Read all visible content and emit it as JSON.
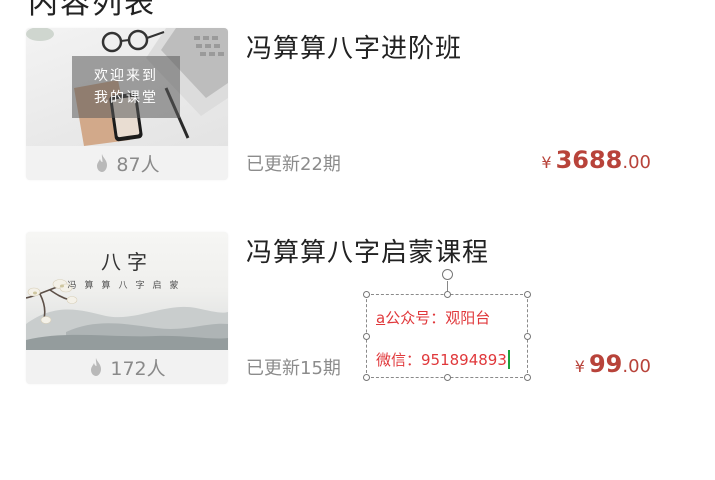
{
  "header": {
    "cut_text": "内容列表"
  },
  "courses": [
    {
      "title": "冯算算八字进阶班",
      "updated": "已更新22期",
      "students": "87人",
      "price_symbol": "¥",
      "price_int": "3688",
      "price_dec": ".00",
      "thumb_text_line1": "欢迎来到",
      "thumb_text_line2": "我的课堂"
    },
    {
      "title": "冯算算八字启蒙课程",
      "updated": "已更新15期",
      "students": "172人",
      "price_symbol": "¥",
      "price_int": "99",
      "price_dec": ".00",
      "thumb_title": "八字",
      "thumb_subtitle": "冯算算八字启蒙"
    }
  ],
  "overlay_textbox": {
    "line1_first": "a",
    "line1_rest": "公众号：观阳台",
    "line2": "微信：951894893"
  },
  "colors": {
    "price": "#b8433a",
    "overlay_text": "#e0383b",
    "caret": "#19a23a"
  },
  "icons": {
    "students": "fire-icon"
  }
}
